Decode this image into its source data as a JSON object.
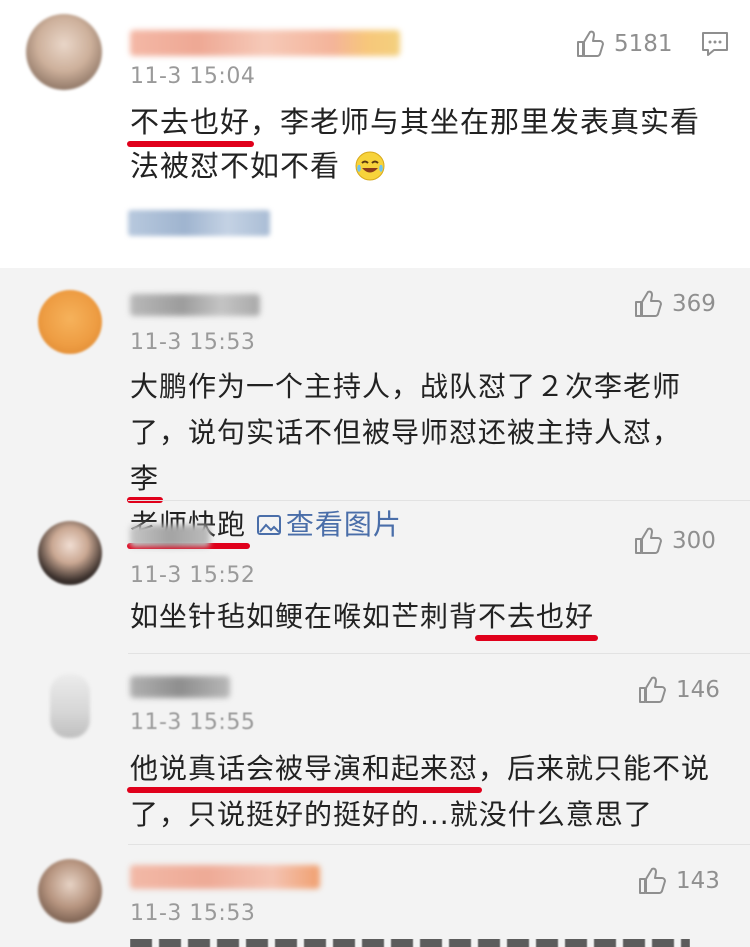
{
  "main_comment": {
    "time": "11-3 15:04",
    "likes": "5181",
    "text_underlined": "不去也好",
    "text_rest": "，李老师与其坐在那里发表真实看法被怼不如不看",
    "emoji": "laugh-cry-emoji"
  },
  "replies": [
    {
      "time": "11-3 15:53",
      "likes": "369",
      "text_plain": "大鹏作为一个主持人，战队怼了２次李老师了，说句实话不但被导师怼还被主持人怼，",
      "text_underlined_1": "李",
      "text_underlined_2": "老师快跑",
      "image_link": "查看图片"
    },
    {
      "time": "11-3 15:52",
      "likes": "300",
      "text_plain": "如坐针毡如鲠在喉如芒刺背",
      "text_underlined": "不去也好"
    },
    {
      "time": "11-3 15:55",
      "likes": "146",
      "text_underlined": "他说真话会被导演和起来怼",
      "text_plain": "，后来就只能不说了，只说挺好的挺好的...就没什么意思了"
    },
    {
      "time": "11-3 15:53",
      "likes": "143"
    }
  ],
  "colors": {
    "underline": "#e0001b",
    "link": "#4a6ea9",
    "muted": "#9a9a9a",
    "reply_bg": "#f3f3f3"
  }
}
